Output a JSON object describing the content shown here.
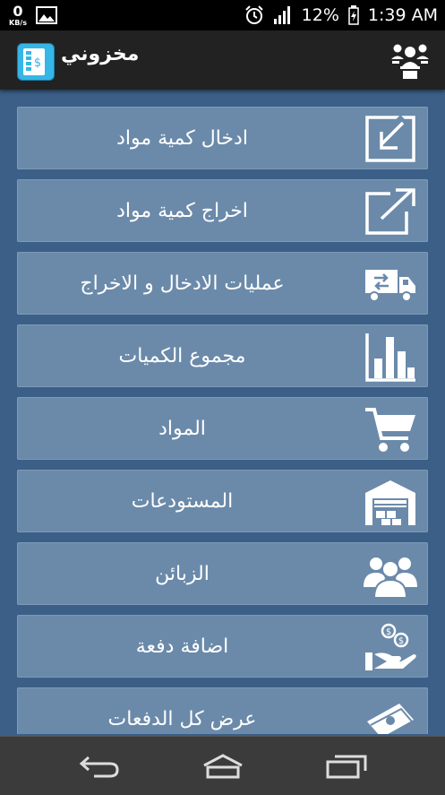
{
  "status": {
    "speed_value": "0",
    "speed_unit": "KB/s",
    "battery": "12%",
    "time": "1:39 AM"
  },
  "app": {
    "title": "مخزوني"
  },
  "menu": [
    {
      "label": "ادخال كمية مواد",
      "icon": "input-box-icon"
    },
    {
      "label": "اخراج كمية مواد",
      "icon": "output-box-icon"
    },
    {
      "label": "عمليات الادخال و الاخراج",
      "icon": "truck-icon"
    },
    {
      "label": "مجموع الكميات",
      "icon": "bar-chart-icon"
    },
    {
      "label": "المواد",
      "icon": "shopping-cart-icon"
    },
    {
      "label": "المستودعات",
      "icon": "warehouse-icon"
    },
    {
      "label": "الزبائن",
      "icon": "customers-icon"
    },
    {
      "label": "اضافة دفعة",
      "icon": "hand-coins-icon"
    },
    {
      "label": "عرض كل الدفعات",
      "icon": "money-icon"
    }
  ],
  "navbar": {
    "back": "back-icon",
    "home": "home-icon",
    "recents": "recents-icon"
  }
}
